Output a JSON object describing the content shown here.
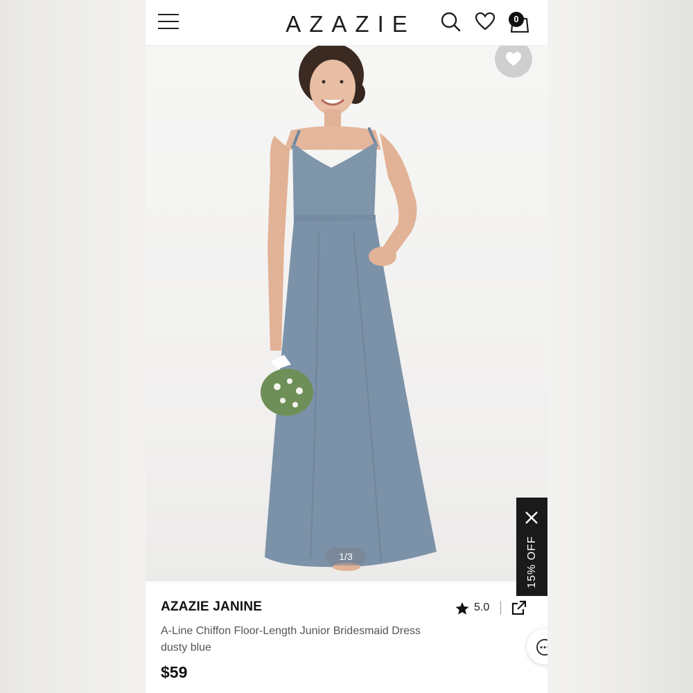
{
  "header": {
    "logo": "AZAZIE",
    "bag_count": "0"
  },
  "gallery": {
    "pager": "1/3"
  },
  "promo": {
    "discount_label": "15% OFF"
  },
  "product": {
    "name": "AZAZIE JANINE",
    "rating": "5.0",
    "description_line1": "A-Line Chiffon Floor-Length Junior Bridesmaid Dress",
    "description_line2": "dusty blue",
    "price": "$59"
  },
  "colors": {
    "dress": "#7f95aa",
    "accent": "#111111"
  },
  "icons": [
    "menu-icon",
    "search-icon",
    "heart-icon",
    "bag-icon",
    "share-icon",
    "star-icon",
    "close-icon",
    "chat-icon"
  ]
}
